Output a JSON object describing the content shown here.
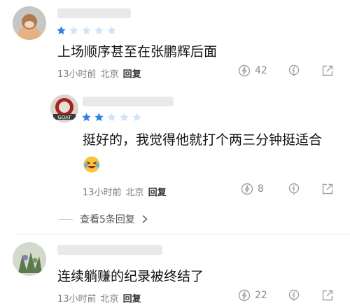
{
  "colors": {
    "star_filled": "#2f80e8",
    "star_empty": "#cfe3f9",
    "meta_text": "#7d7d7d",
    "icon": "#a0a0a0"
  },
  "comments": [
    {
      "rating": 1,
      "text": "上场顺序甚至在张鹏辉后面",
      "time": "13小时前",
      "location": "北京",
      "reply_label": "回复",
      "like_count": "42"
    },
    {
      "rating": 2,
      "text": "挺好的，我觉得他就打个两三分钟挺适合",
      "emoji": "laughing-crying",
      "time": "13小时前",
      "location": "北京",
      "reply_label": "回复",
      "like_count": "8"
    },
    {
      "rating": 0,
      "text": "连续躺赚的纪录被终结了",
      "time": "13小时前",
      "location": "北京",
      "reply_label": "回复",
      "like_count": "22"
    }
  ],
  "expand_replies": "查看5条回复",
  "icons": [
    "lightning-like-icon",
    "dislike-icon",
    "share-icon",
    "chevron-right-icon"
  ]
}
